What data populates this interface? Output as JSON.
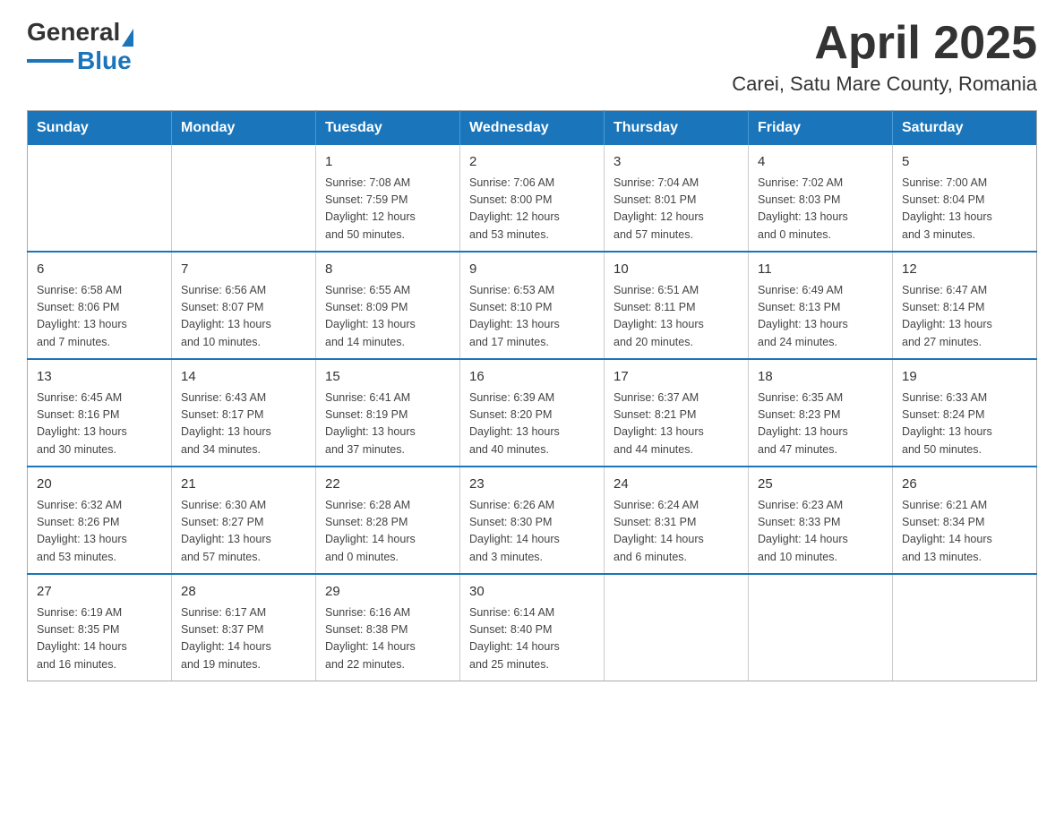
{
  "logo": {
    "text_general": "General",
    "text_blue": "Blue"
  },
  "title": "April 2025",
  "subtitle": "Carei, Satu Mare County, Romania",
  "weekdays": [
    "Sunday",
    "Monday",
    "Tuesday",
    "Wednesday",
    "Thursday",
    "Friday",
    "Saturday"
  ],
  "weeks": [
    [
      {
        "day": "",
        "info": ""
      },
      {
        "day": "",
        "info": ""
      },
      {
        "day": "1",
        "info": "Sunrise: 7:08 AM\nSunset: 7:59 PM\nDaylight: 12 hours\nand 50 minutes."
      },
      {
        "day": "2",
        "info": "Sunrise: 7:06 AM\nSunset: 8:00 PM\nDaylight: 12 hours\nand 53 minutes."
      },
      {
        "day": "3",
        "info": "Sunrise: 7:04 AM\nSunset: 8:01 PM\nDaylight: 12 hours\nand 57 minutes."
      },
      {
        "day": "4",
        "info": "Sunrise: 7:02 AM\nSunset: 8:03 PM\nDaylight: 13 hours\nand 0 minutes."
      },
      {
        "day": "5",
        "info": "Sunrise: 7:00 AM\nSunset: 8:04 PM\nDaylight: 13 hours\nand 3 minutes."
      }
    ],
    [
      {
        "day": "6",
        "info": "Sunrise: 6:58 AM\nSunset: 8:06 PM\nDaylight: 13 hours\nand 7 minutes."
      },
      {
        "day": "7",
        "info": "Sunrise: 6:56 AM\nSunset: 8:07 PM\nDaylight: 13 hours\nand 10 minutes."
      },
      {
        "day": "8",
        "info": "Sunrise: 6:55 AM\nSunset: 8:09 PM\nDaylight: 13 hours\nand 14 minutes."
      },
      {
        "day": "9",
        "info": "Sunrise: 6:53 AM\nSunset: 8:10 PM\nDaylight: 13 hours\nand 17 minutes."
      },
      {
        "day": "10",
        "info": "Sunrise: 6:51 AM\nSunset: 8:11 PM\nDaylight: 13 hours\nand 20 minutes."
      },
      {
        "day": "11",
        "info": "Sunrise: 6:49 AM\nSunset: 8:13 PM\nDaylight: 13 hours\nand 24 minutes."
      },
      {
        "day": "12",
        "info": "Sunrise: 6:47 AM\nSunset: 8:14 PM\nDaylight: 13 hours\nand 27 minutes."
      }
    ],
    [
      {
        "day": "13",
        "info": "Sunrise: 6:45 AM\nSunset: 8:16 PM\nDaylight: 13 hours\nand 30 minutes."
      },
      {
        "day": "14",
        "info": "Sunrise: 6:43 AM\nSunset: 8:17 PM\nDaylight: 13 hours\nand 34 minutes."
      },
      {
        "day": "15",
        "info": "Sunrise: 6:41 AM\nSunset: 8:19 PM\nDaylight: 13 hours\nand 37 minutes."
      },
      {
        "day": "16",
        "info": "Sunrise: 6:39 AM\nSunset: 8:20 PM\nDaylight: 13 hours\nand 40 minutes."
      },
      {
        "day": "17",
        "info": "Sunrise: 6:37 AM\nSunset: 8:21 PM\nDaylight: 13 hours\nand 44 minutes."
      },
      {
        "day": "18",
        "info": "Sunrise: 6:35 AM\nSunset: 8:23 PM\nDaylight: 13 hours\nand 47 minutes."
      },
      {
        "day": "19",
        "info": "Sunrise: 6:33 AM\nSunset: 8:24 PM\nDaylight: 13 hours\nand 50 minutes."
      }
    ],
    [
      {
        "day": "20",
        "info": "Sunrise: 6:32 AM\nSunset: 8:26 PM\nDaylight: 13 hours\nand 53 minutes."
      },
      {
        "day": "21",
        "info": "Sunrise: 6:30 AM\nSunset: 8:27 PM\nDaylight: 13 hours\nand 57 minutes."
      },
      {
        "day": "22",
        "info": "Sunrise: 6:28 AM\nSunset: 8:28 PM\nDaylight: 14 hours\nand 0 minutes."
      },
      {
        "day": "23",
        "info": "Sunrise: 6:26 AM\nSunset: 8:30 PM\nDaylight: 14 hours\nand 3 minutes."
      },
      {
        "day": "24",
        "info": "Sunrise: 6:24 AM\nSunset: 8:31 PM\nDaylight: 14 hours\nand 6 minutes."
      },
      {
        "day": "25",
        "info": "Sunrise: 6:23 AM\nSunset: 8:33 PM\nDaylight: 14 hours\nand 10 minutes."
      },
      {
        "day": "26",
        "info": "Sunrise: 6:21 AM\nSunset: 8:34 PM\nDaylight: 14 hours\nand 13 minutes."
      }
    ],
    [
      {
        "day": "27",
        "info": "Sunrise: 6:19 AM\nSunset: 8:35 PM\nDaylight: 14 hours\nand 16 minutes."
      },
      {
        "day": "28",
        "info": "Sunrise: 6:17 AM\nSunset: 8:37 PM\nDaylight: 14 hours\nand 19 minutes."
      },
      {
        "day": "29",
        "info": "Sunrise: 6:16 AM\nSunset: 8:38 PM\nDaylight: 14 hours\nand 22 minutes."
      },
      {
        "day": "30",
        "info": "Sunrise: 6:14 AM\nSunset: 8:40 PM\nDaylight: 14 hours\nand 25 minutes."
      },
      {
        "day": "",
        "info": ""
      },
      {
        "day": "",
        "info": ""
      },
      {
        "day": "",
        "info": ""
      }
    ]
  ]
}
